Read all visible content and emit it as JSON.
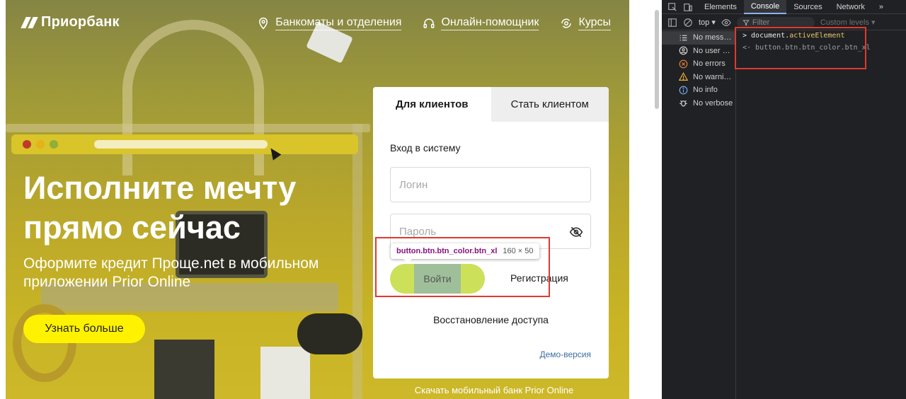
{
  "site": {
    "logo_text": "Приорбанк",
    "nav": {
      "atms": "Банкоматы и отделения",
      "assistant": "Онлайн-помощник",
      "rates": "Курсы"
    },
    "hero_title": "Исполните мечту прямо сейчас",
    "hero_subtitle": "Оформите кредит Проще.net в мобильном приложении Prior Online",
    "cta_label": "Узнать больше",
    "download_text": "Скачать мобильный банк Prior Online",
    "colors": {
      "cta": "#fff200",
      "login_button": "#cde05a",
      "link": "#3b6ea5"
    }
  },
  "login_card": {
    "tab_clients": "Для клиентов",
    "tab_become_client": "Стать клиентом",
    "heading": "Вход в систему",
    "login_placeholder": "Логин",
    "password_placeholder": "Пароль",
    "login_button": "Войти",
    "register_link": "Регистрация",
    "restore_link": "Восстановление доступа",
    "demo_link": "Демо-версия"
  },
  "inspect_tooltip": {
    "selector": "button.btn.btn_color.btn_xl",
    "size": "160 × 50"
  },
  "devtools": {
    "tabs": [
      "Elements",
      "Console",
      "Sources",
      "Network"
    ],
    "active_tab": "Console",
    "more_tabs": "»",
    "context": "top ▾",
    "filter_placeholder": "Filter",
    "levels": "Custom levels ▾",
    "sidebar": [
      {
        "label": "No mess…",
        "icon": "list-icon"
      },
      {
        "label": "No user …",
        "icon": "user-icon"
      },
      {
        "label": "No errors",
        "icon": "error-icon"
      },
      {
        "label": "No warni…",
        "icon": "warning-icon"
      },
      {
        "label": "No info",
        "icon": "info-icon"
      },
      {
        "label": "No verbose",
        "icon": "bug-icon"
      }
    ],
    "console_input_prefix": "document.",
    "console_input_prop": "activeElement",
    "console_output": "button.btn.btn_color.btn_xl"
  }
}
